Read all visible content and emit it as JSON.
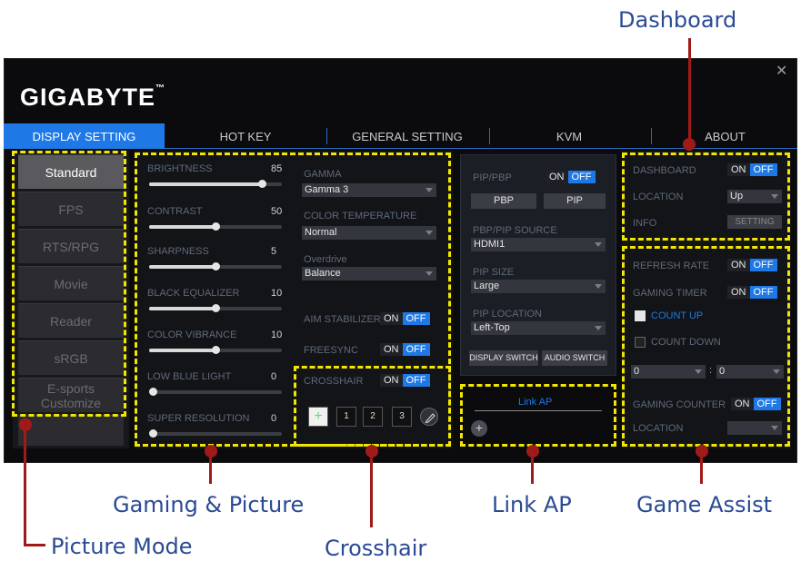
{
  "callouts": {
    "dashboard": "Dashboard",
    "gaming_picture": "Gaming & Picture",
    "picture_mode": "Picture Mode",
    "crosshair": "Crosshair",
    "link_ap": "Link AP",
    "game_assist": "Game Assist"
  },
  "app": {
    "logo": "GIGABYTE",
    "tm": "™",
    "close": "✕"
  },
  "tabs": [
    "DISPLAY SETTING",
    "HOT KEY",
    "GENERAL SETTING",
    "KVM",
    "ABOUT"
  ],
  "modes": [
    "Standard",
    "FPS",
    "RTS/RPG",
    "Movie",
    "Reader",
    "sRGB",
    "E-sports Customize"
  ],
  "picture": [
    {
      "label": "BRIGHTNESS",
      "value": "85",
      "level": 0.85
    },
    {
      "label": "CONTRAST",
      "value": "50",
      "level": 0.5
    },
    {
      "label": "SHARPNESS",
      "value": "5",
      "level": 0.5
    },
    {
      "label": "BLACK EQUALIZER",
      "value": "10",
      "level": 0.5
    },
    {
      "label": "COLOR VIBRANCE",
      "value": "10",
      "level": 0.5
    },
    {
      "label": "LOW BLUE LIGHT",
      "value": "0",
      "level": 0.0
    },
    {
      "label": "SUPER RESOLUTION",
      "value": "0",
      "level": 0.0
    }
  ],
  "gamma": {
    "label": "GAMMA",
    "value": "Gamma 3",
    "color_temp_label": "COLOR TEMPERATURE",
    "color_temp_value": "Normal",
    "overdrive_label": "Overdrive",
    "overdrive_value": "Balance",
    "aim_label": "AIM STABILIZER",
    "freesync_label": "FREESYNC"
  },
  "toggle": {
    "on": "ON",
    "off": "OFF"
  },
  "crosshair": {
    "label": "CROSSHAIR",
    "b1": "1",
    "b2": "2",
    "b3": "3",
    "plus": "+"
  },
  "pip": {
    "label": "PIP/PBP",
    "pbp": "PBP",
    "pip": "PIP",
    "source_label": "PBP/PIP SOURCE",
    "source_value": "HDMI1",
    "size_label": "PIP SIZE",
    "size_value": "Large",
    "location_label": "PIP LOCATION",
    "location_value": "Left-Top",
    "display_switch": "DISPLAY SWITCH",
    "audio_switch": "AUDIO SWITCH"
  },
  "link": {
    "label": "Link AP",
    "add": "+"
  },
  "dashboard": {
    "label": "DASHBOARD",
    "location_label": "LOCATION",
    "location_value": "Up",
    "info_label": "INFO",
    "setting": "SETTING"
  },
  "assist": {
    "refresh_label": "REFRESH RATE",
    "timer_label": "GAMING TIMER",
    "count_up": "COUNT UP",
    "count_down": "COUNT DOWN",
    "min": "0",
    "colon": ":",
    "sec": "0",
    "counter_label": "GAMING COUNTER",
    "location_label": "LOCATION"
  },
  "colors": {
    "accent": "#1e78e6",
    "callout": "#2a4a94",
    "highlight": "#f2e600",
    "leader": "#a11a1a"
  }
}
